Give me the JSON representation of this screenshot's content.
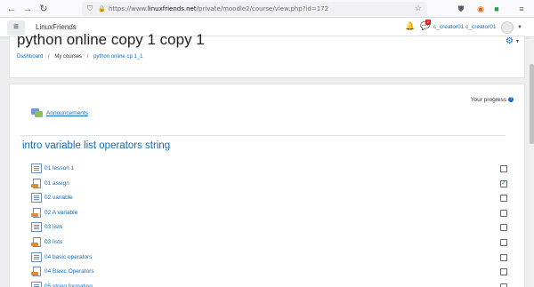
{
  "browser": {
    "url_prefix": "https://www.",
    "url_domain": "linuxfriends.net",
    "url_path": "/private/moodle2/course/view.php?id=172",
    "nav": {
      "back": "←",
      "forward": "→",
      "reload": "↻"
    },
    "icons": [
      "shield-icon",
      "lock-icon",
      "star-icon",
      "pocket-icon",
      "firefox-icon",
      "extension-icon",
      "menu-icon"
    ]
  },
  "navbar": {
    "menu_glyph": "≡",
    "brand": "LinuxFriends",
    "user_name": "c_creator01 c_creator01",
    "message_badge": "1"
  },
  "header": {
    "title": "python online copy 1 copy 1",
    "breadcrumb": [
      "Dashboard",
      "My courses",
      "python online cp 1_1"
    ]
  },
  "content": {
    "progress_label": "Your progress",
    "announcements": "Announcements",
    "section_title": "intro variable list operators string",
    "activities": [
      {
        "name": "01 lesson 1",
        "type": "page",
        "completed": false
      },
      {
        "name": "01 assign",
        "type": "assign",
        "completed": true
      },
      {
        "name": "02 variable",
        "type": "page",
        "completed": false
      },
      {
        "name": "02 A variable",
        "type": "assign",
        "completed": false
      },
      {
        "name": "03 lists",
        "type": "page",
        "completed": false
      },
      {
        "name": "03 lists",
        "type": "assign",
        "completed": false
      },
      {
        "name": "04 basic operators",
        "type": "page",
        "completed": false
      },
      {
        "name": "04 Basic Operators",
        "type": "assign",
        "completed": false
      },
      {
        "name": "05 string formating",
        "type": "page",
        "completed": false
      }
    ]
  },
  "colors": {
    "link": "#0f6cbf",
    "background": "#eeeeee"
  }
}
